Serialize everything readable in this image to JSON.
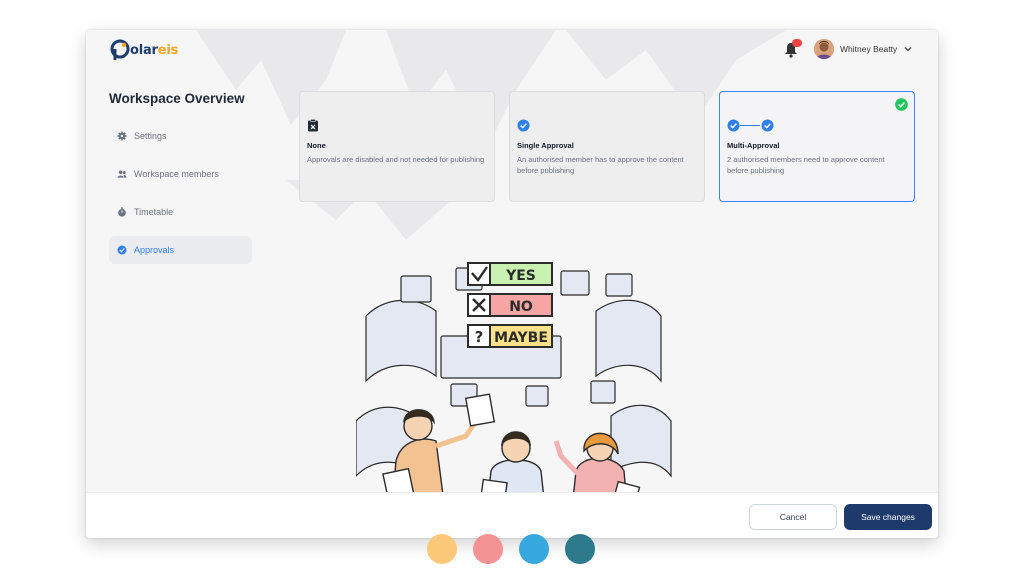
{
  "brand": {
    "logo_text_main": "olar",
    "logo_text_accent": "eis",
    "logo_initial": "P",
    "colors": {
      "navy": "#1d3d6e",
      "orange": "#f5a524"
    }
  },
  "header": {
    "notification_icon": "bell-icon",
    "user_name": "Whitney Beatty",
    "user_menu_icon": "chevron-down-icon"
  },
  "page": {
    "title": "Workspace Overview"
  },
  "sidebar": {
    "items": [
      {
        "label": "Settings",
        "icon": "gear-icon",
        "active": false
      },
      {
        "label": "Workspace members",
        "icon": "users-icon",
        "active": false
      },
      {
        "label": "Timetable",
        "icon": "stopwatch-icon",
        "active": false
      },
      {
        "label": "Approvals",
        "icon": "check-circle-icon",
        "active": true
      }
    ]
  },
  "approval_options": [
    {
      "title": "None",
      "description": "Approvals are disabled and not needed for publishing",
      "icon": "clipboard-x-icon",
      "selected": false
    },
    {
      "title": "Single Approval",
      "description": "An authorised member has to approve the content before publishing",
      "icon": "check-circle-icon",
      "selected": false
    },
    {
      "title": "Multi-Approval",
      "description": "2 authorised members need to approve content before publishing",
      "icon": "double-check-icon",
      "selected": true
    }
  ],
  "illustration": {
    "labels": {
      "yes": "YES",
      "no": "NO",
      "maybe": "MAYBE",
      "question": "?"
    },
    "colors": {
      "yes": "#c8f0b0",
      "no": "#f6a4a4",
      "maybe": "#fbe08a"
    }
  },
  "footer": {
    "cancel_label": "Cancel",
    "save_label": "Save changes"
  },
  "palette_dots": [
    "#fcc97a",
    "#f39393",
    "#36a8dd",
    "#2c7a8c"
  ],
  "accent_color": "#3b82f6",
  "success_color": "#22c55e"
}
